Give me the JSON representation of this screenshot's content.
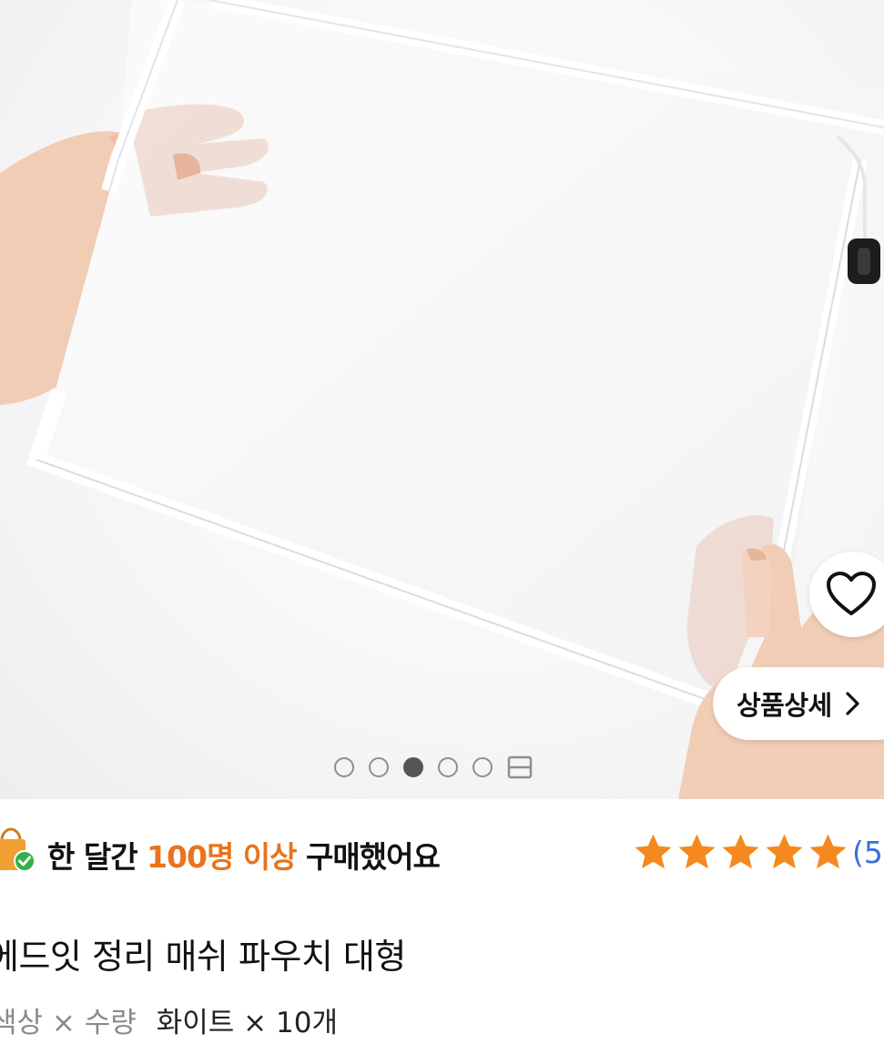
{
  "gallery": {
    "page_count": 5,
    "active_index": 2
  },
  "actions": {
    "favorite_icon": "heart-icon",
    "detail_label": "상품상세",
    "detail_chevron": "›"
  },
  "purchase_badge": {
    "icon": "shopping-bag-check-icon",
    "prefix": "한 달간 ",
    "highlight": "100명 이상",
    "suffix": " 구매했어요",
    "highlight_color": "#e9731c"
  },
  "rating": {
    "stars": 5,
    "count_text": "(5",
    "star_color": "#f5891f"
  },
  "product": {
    "title": "에드잇 정리 매쉬 파우치 대형"
  },
  "option": {
    "label": "색상 × 수량",
    "value": "화이트 × 10개"
  }
}
